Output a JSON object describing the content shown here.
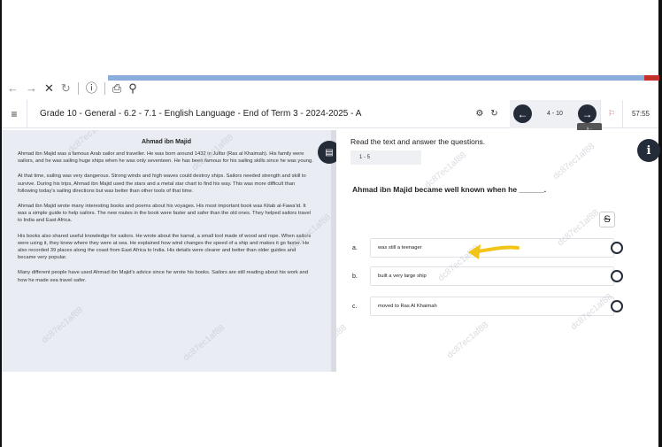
{
  "browser": {
    "back_icon": "←",
    "forward_icon": "→",
    "close_icon": "✕",
    "reload_icon": "↻",
    "info_icon": "ⓘ",
    "tab_icon": "⎙",
    "zoom_icon": "⚲"
  },
  "header": {
    "menu_icon": "≡",
    "title": "Grade 10 - General - 6.2 - 7.1 - English Language - End of Term 3 - 2024-2025 - A",
    "settings_icon": "⚙",
    "refresh_icon": "↻",
    "prev_icon": "←",
    "next_icon": "→",
    "page_indicator": "4 - 10",
    "flag_icon": "⚐",
    "timer": "57:55",
    "tooltip": "وَ..."
  },
  "reading": {
    "title": "Ahmad ibn Majid",
    "paragraphs": [
      "Ahmad ibn Majid was a famous Arab sailor and traveller. He was born around 1432 in Julfar (Ras al Khaimah). His family were sailors, and he was sailing huge ships when he was only seventeen. He has been famous for his sailing skills since he was young.",
      "At that time, sailing was very dangerous. Strong winds and high waves could destroy ships. Sailors needed strength and skill to survive. During his trips, Ahmad ibn Majid used the stars and a metal star chart to find his way. This was more difficult than following today's sailing directions but was better than other tools of that time.",
      "Ahmad ibn Majid wrote many interesting books and poems about his voyages. His most important book was Kitab al-Fawa'id. It was a simple guide to help sailors. The new routes in the book were faster and safer than the old ones. They helped sailors travel to India and East Africa.",
      "His books also shared useful knowledge for sailors. He wrote about the kamal, a small tool made of wood and rope. When sailors were using it, they knew where they were at sea. He explained how wind changes the speed of a ship and makes it go faster. He also recorded 39 places along the coast from East Africa to India. His details were clearer and better than older guides and became very popular.",
      "Many different people have used Ahmad ibn Majid's advice since he wrote his books. Sailors are still reading about his work and how he made sea travel safer."
    ],
    "doc_icon": "▤"
  },
  "question": {
    "instructions": "Read the text and answer the questions.",
    "range": "1 - 5",
    "prompt": "Ahmad ibn Majid became well known when he ______.",
    "strike_icon": "S",
    "info_icon": "i",
    "options": [
      {
        "letter": "a.",
        "text": "was still a teenager"
      },
      {
        "letter": "b.",
        "text": "built a very large ship"
      },
      {
        "letter": "c.",
        "text": "moved to Ras Al Khaimah"
      }
    ]
  },
  "watermark": "dc87ec1af88",
  "colors": {
    "accent_dark": "#242c39",
    "reading_bg": "#e9edf3",
    "progress": "#8aaedb",
    "annotation_arrow": "#f2c417"
  }
}
